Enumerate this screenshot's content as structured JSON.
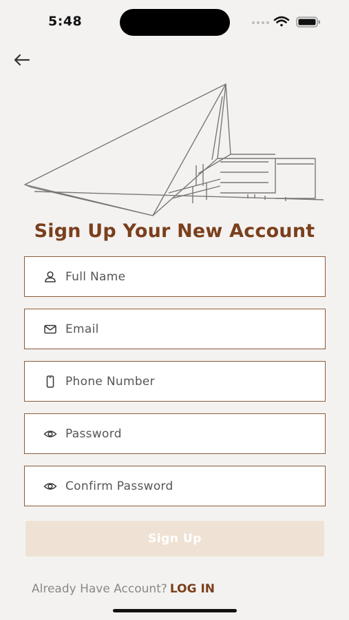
{
  "status": {
    "time": "5:48"
  },
  "title": "Sign Up Your New Account",
  "fields": [
    {
      "placeholder": "Full Name",
      "icon": "person-icon"
    },
    {
      "placeholder": "Email",
      "icon": "mail-icon"
    },
    {
      "placeholder": "Phone Number",
      "icon": "phone-icon"
    },
    {
      "placeholder": "Password",
      "icon": "eye-icon"
    },
    {
      "placeholder": "Confirm Password",
      "icon": "eye-icon"
    }
  ],
  "signup_button": "Sign Up",
  "footer": {
    "prompt": "Already Have Account?",
    "login": "LOG IN"
  },
  "colors": {
    "accent": "#7a3f1d",
    "border": "#8a5a3a",
    "button_bg": "#efe2d4",
    "background": "#f4f2f0"
  }
}
